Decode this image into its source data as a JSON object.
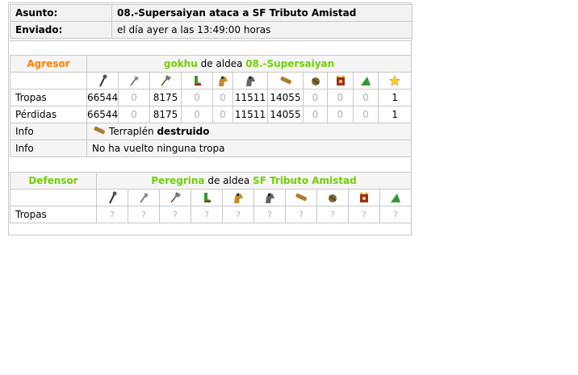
{
  "message": {
    "subject_label": "Asunto:",
    "subject": "08.-Supersaiyan ataca a SF Tributo Amistad",
    "sent_label": "Enviado:",
    "sent": "el día ayer a las 13:49:00 horas"
  },
  "attacker": {
    "role": "Agresor",
    "player": "gokhu",
    "village_prefix": "de aldea",
    "village": "08.-Supersaiyan",
    "troops_label": "Tropas",
    "troops": [
      "66544",
      "0",
      "8175",
      "0",
      "0",
      "11511",
      "14055",
      "0",
      "0",
      "0",
      "1"
    ],
    "losses_label": "Pérdidas",
    "losses": [
      "66544",
      "0",
      "8175",
      "0",
      "0",
      "11511",
      "14055",
      "0",
      "0",
      "0",
      "1"
    ],
    "info1_label": "Info",
    "info1_text": "Terraplén ",
    "info1_bold": "destruido",
    "info2_label": "Info",
    "info2_text": "No ha vuelto ninguna tropa"
  },
  "defender": {
    "role": "Defensor",
    "player": "Peregrina",
    "village_prefix": "de aldea",
    "village": "SF Tributo Amistad",
    "troops_label": "Tropas",
    "troops": [
      "?",
      "?",
      "?",
      "?",
      "?",
      "?",
      "?",
      "?",
      "?",
      "?"
    ]
  },
  "unit_icons": [
    "club-icon",
    "axe-icon",
    "tomahawk-icon",
    "scout-boot-icon",
    "paladin-horse-icon",
    "teutonic-knight-horse-icon",
    "battering-ram-icon",
    "catapult-icon",
    "chief-icon",
    "settler-icon",
    "hero-star-icon"
  ],
  "colors": {
    "accent_green": "#71d000",
    "accent_orange": "#ff8000",
    "border": "#c8c8c8",
    "header_bg": "#f2f2f2"
  }
}
